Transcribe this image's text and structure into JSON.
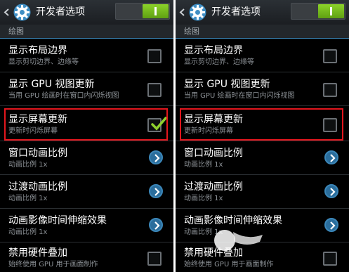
{
  "screens": [
    {
      "title": "开发者选项",
      "section": "绘图",
      "rows": [
        {
          "title": "显示布局边界",
          "sub": "显示剪切边界、边缘等",
          "control": "checkbox",
          "checked": false
        },
        {
          "title": "显示 GPU 视图更新",
          "sub": "当用 GPU 绘画时在窗口内闪烁视图",
          "control": "checkbox",
          "checked": false
        },
        {
          "title": "显示屏幕更新",
          "sub": "更新时闪烁屏幕",
          "control": "checkbox",
          "checked": true
        },
        {
          "title": "窗口动画比例",
          "sub": "动画比例 1x",
          "control": "chevron"
        },
        {
          "title": "过渡动画比例",
          "sub": "动画比例 1x",
          "control": "chevron"
        },
        {
          "title": "动画影像时间伸缩效果",
          "sub": "动画比例 1x",
          "control": "chevron"
        },
        {
          "title": "禁用硬件叠加",
          "sub": "始终使用 GPU 用于画面制作",
          "control": "checkbox",
          "checked": false
        }
      ]
    },
    {
      "title": "开发者选项",
      "section": "绘图",
      "rows": [
        {
          "title": "显示布局边界",
          "sub": "显示剪切边界、边缘等",
          "control": "checkbox",
          "checked": false
        },
        {
          "title": "显示 GPU 视图更新",
          "sub": "当用 GPU 绘画时在窗口内闪烁视图",
          "control": "checkbox",
          "checked": false
        },
        {
          "title": "显示屏幕更新",
          "sub": "更新时闪烁屏幕",
          "control": "checkbox",
          "checked": false
        },
        {
          "title": "窗口动画比例",
          "sub": "动画比例 1x",
          "control": "chevron"
        },
        {
          "title": "过渡动画比例",
          "sub": "动画比例 1x",
          "control": "chevron"
        },
        {
          "title": "动画影像时间伸缩效果",
          "sub": "动画比例 1x",
          "control": "chevron"
        },
        {
          "title": "禁用硬件叠加",
          "sub": "始终使用 GPU 用于画面制作",
          "control": "checkbox",
          "checked": false
        }
      ]
    }
  ],
  "developer_toggle_on": true,
  "colors": {
    "toggle_on": "#7bc121",
    "accent_blue": "#3b86b8",
    "highlight_red": "#e2161d",
    "check_green": "#8fd12d"
  },
  "icons": {
    "back": "chevron-left-icon",
    "app": "settings-gear-icon",
    "chevron": "chevron-right-icon",
    "check": "checkmark-icon"
  }
}
